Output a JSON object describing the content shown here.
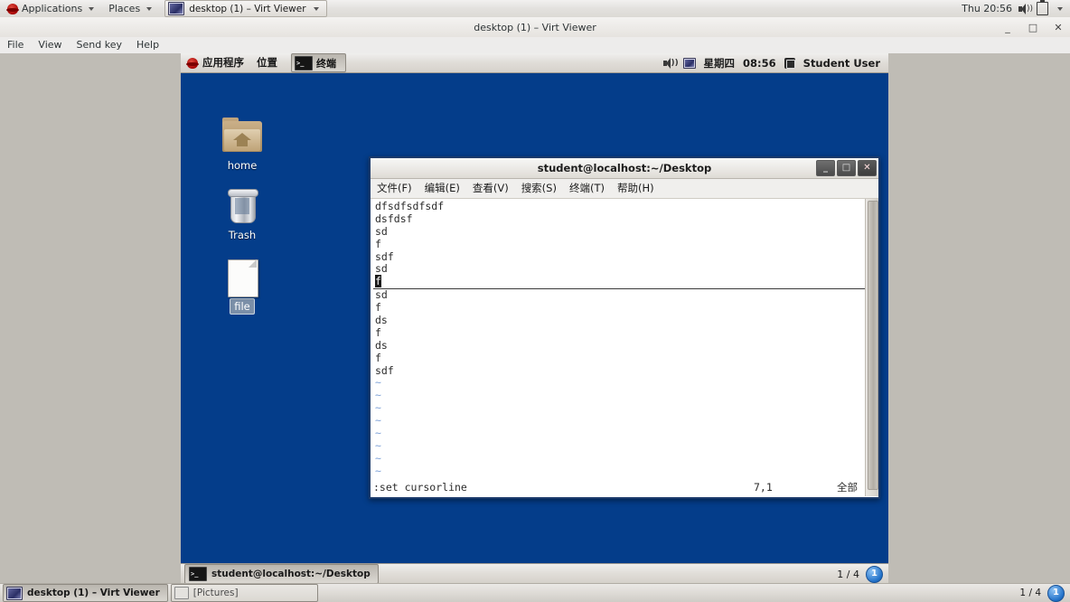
{
  "host_panel": {
    "applications_label": "Applications",
    "places_label": "Places",
    "window_button_label": "desktop (1) – Virt Viewer",
    "clock": "Thu 20:56"
  },
  "virt_viewer": {
    "title": "desktop (1) – Virt Viewer",
    "minimize_label": "_",
    "maximize_label": "□",
    "close_label": "✕",
    "menu": [
      "File",
      "View",
      "Send key",
      "Help"
    ]
  },
  "guest": {
    "top_panel": {
      "applications_label": "应用程序",
      "places_label": "位置",
      "task_label": "终端",
      "day_label": "星期四",
      "clock": "08:56",
      "user_label": "Student User"
    },
    "desktop_icons": [
      {
        "name": "home",
        "label": "home",
        "selected": false
      },
      {
        "name": "trash",
        "label": "Trash",
        "selected": false
      },
      {
        "name": "file",
        "label": "file",
        "selected": true
      }
    ],
    "bottom_panel": {
      "task_label": "student@localhost:~/Desktop",
      "workspace_text": "1 / 4",
      "workspace_badge": "1"
    }
  },
  "terminal": {
    "title": "student@localhost:~/Desktop",
    "window_buttons": {
      "minimize": "_",
      "maximize": "□",
      "close": "✕"
    },
    "menu": [
      "文件(F)",
      "编辑(E)",
      "查看(V)",
      "搜索(S)",
      "终端(T)",
      "帮助(H)"
    ],
    "vim": {
      "lines": [
        {
          "text": "dfsdfsdfsdf",
          "type": "text"
        },
        {
          "text": "dsfdsf",
          "type": "text"
        },
        {
          "text": "sd",
          "type": "text"
        },
        {
          "text": "f",
          "type": "text"
        },
        {
          "text": "sdf",
          "type": "text"
        },
        {
          "text": "sd",
          "type": "text"
        },
        {
          "text": "f",
          "type": "cursorline"
        },
        {
          "text": "sd",
          "type": "text"
        },
        {
          "text": "f",
          "type": "text"
        },
        {
          "text": "ds",
          "type": "text"
        },
        {
          "text": "f",
          "type": "text"
        },
        {
          "text": "ds",
          "type": "text"
        },
        {
          "text": "f",
          "type": "text"
        },
        {
          "text": "sdf",
          "type": "text"
        },
        {
          "text": "~",
          "type": "tilde"
        },
        {
          "text": "~",
          "type": "tilde"
        },
        {
          "text": "~",
          "type": "tilde"
        },
        {
          "text": "~",
          "type": "tilde"
        },
        {
          "text": "~",
          "type": "tilde"
        },
        {
          "text": "~",
          "type": "tilde"
        },
        {
          "text": "~",
          "type": "tilde"
        },
        {
          "text": "~",
          "type": "tilde"
        }
      ],
      "cursor_char": "f",
      "status_command": ":set cursorline",
      "status_position": "7,1",
      "status_scroll": "全部"
    }
  },
  "host_taskbar": {
    "tasks": [
      {
        "label": "desktop (1) – Virt Viewer",
        "active": true
      },
      {
        "label": "[Pictures]",
        "active": false
      }
    ],
    "workspace_text": "1 / 4",
    "workspace_badge": "1"
  },
  "colors": {
    "desktop_blue": "#043d8a",
    "window_border": "#1b3a6b",
    "tilde_blue": "#7fa2d8",
    "panel_gray": "#e0ddd8"
  }
}
